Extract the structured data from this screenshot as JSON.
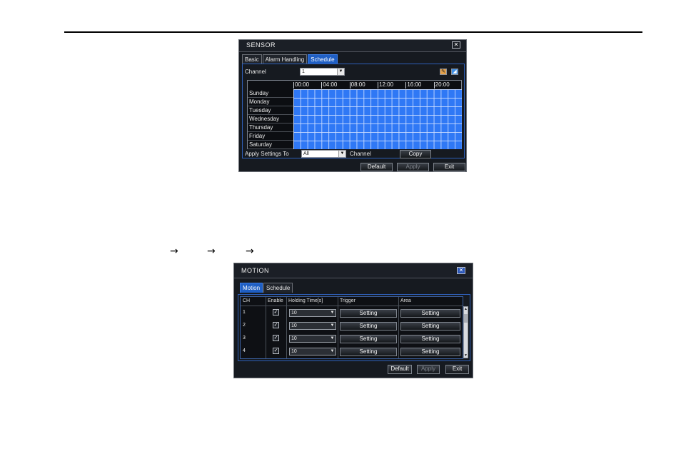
{
  "arrows": [
    "→",
    "→",
    "→"
  ],
  "sensor": {
    "title": "SENSOR",
    "close": "✕",
    "tabs": [
      "Basic",
      "Alarm Handling",
      "Schedule"
    ],
    "channel_label": "Channel",
    "channel_value": "1",
    "hours": [
      "00:00",
      "04:00",
      "08:00",
      "12:00",
      "16:00",
      "20:00"
    ],
    "days": [
      "Sunday",
      "Monday",
      "Tuesday",
      "Wednesday",
      "Thursday",
      "Friday",
      "Saturday"
    ],
    "apply_label": "Apply Settings To",
    "apply_value": "All",
    "channel_word": "Channel",
    "copy": "Copy",
    "default": "Default",
    "apply": "Apply",
    "exit": "Exit",
    "colors": {
      "accent": "#2f78f5",
      "panel_border": "#2e5fb8"
    }
  },
  "motion": {
    "title": "MOTION",
    "close": "✕",
    "tabs": [
      "Motion",
      "Schedule"
    ],
    "headers": [
      "CH",
      "Enable",
      "Holding Time[s]",
      "Trigger",
      "Area"
    ],
    "rows": [
      {
        "ch": "1",
        "enable": "✓",
        "holding": "10",
        "trigger": "Setting",
        "area": "Setting"
      },
      {
        "ch": "2",
        "enable": "✓",
        "holding": "10",
        "trigger": "Setting",
        "area": "Setting"
      },
      {
        "ch": "3",
        "enable": "✓",
        "holding": "10",
        "trigger": "Setting",
        "area": "Setting"
      },
      {
        "ch": "4",
        "enable": "✓",
        "holding": "10",
        "trigger": "Setting",
        "area": "Setting"
      }
    ],
    "default": "Default",
    "apply": "Apply",
    "exit": "Exit"
  }
}
